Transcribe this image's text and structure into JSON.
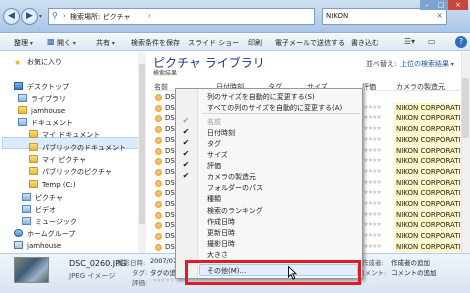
{
  "addressbar": {
    "path_text": "検索場所: ピクチャ",
    "refresh_icon": "refresh-arrows"
  },
  "search": {
    "value": "NIKON"
  },
  "toolbar": {
    "organize": "整理",
    "open": "開く",
    "share": "共有",
    "save_search": "検索条件を保存",
    "slideshow": "スライド ショー",
    "print": "印刷",
    "email": "電子メールで送信する",
    "burn": "書き込む"
  },
  "sidebar": {
    "items": [
      {
        "label": "お気に入り",
        "icon": "star"
      },
      {
        "label": "デスクトップ",
        "icon": "desktop"
      },
      {
        "label": "ライブラリ",
        "icon": "library"
      },
      {
        "label": "jamhouse",
        "icon": "user-folder"
      },
      {
        "label": "ドキュメント",
        "icon": "library"
      },
      {
        "label": "マイ ドキュメント",
        "icon": "folder"
      },
      {
        "label": "パブリックのドキュメント",
        "icon": "folder"
      },
      {
        "label": "マイ ピクチャ",
        "icon": "folder"
      },
      {
        "label": "パブリックのピクチャ",
        "icon": "folder"
      },
      {
        "label": "Temp (C:)",
        "icon": "folder"
      },
      {
        "label": "ピクチャ",
        "icon": "library"
      },
      {
        "label": "ビデオ",
        "icon": "library"
      },
      {
        "label": "ミュージック",
        "icon": "library"
      },
      {
        "label": "ホームグループ",
        "icon": "network"
      },
      {
        "label": "jamhouse",
        "icon": "computer"
      }
    ]
  },
  "library": {
    "title": "ピクチャ ライブラリ",
    "subtitle": "検索結果",
    "arrange_label": "並べ替え:",
    "arrange_value": "上位の検索結果"
  },
  "columns": {
    "name": "名前",
    "date": "日付時刻",
    "tag": "タグ",
    "size": "サイズ",
    "rating": "評価",
    "camera": "カメラの製造元"
  },
  "files": [
    {
      "name": "DSC_0",
      "camera": ""
    },
    {
      "name": "DSC_02",
      "camera": "NIKON CORPORATION"
    },
    {
      "name": "DSC_02",
      "camera": "NIKON CORPORATION"
    },
    {
      "name": "DSC_02",
      "camera": "NIKON CORPORATION"
    },
    {
      "name": "DSC_02",
      "camera": "NIKON CORPORATION"
    },
    {
      "name": "DSC_02",
      "camera": "NIKON CORPORATION"
    },
    {
      "name": "DSC_02",
      "camera": "NIKON CORPORATION"
    },
    {
      "name": "DSC_02",
      "camera": "NIKON CORPORATION"
    },
    {
      "name": "DSC_02",
      "camera": "NIKON CORPORATION"
    },
    {
      "name": "DSC_02",
      "camera": "NIKON CORPORATION"
    },
    {
      "name": "DSC_02",
      "camera": "NIKON CORPORATION"
    },
    {
      "name": "DSC_02",
      "camera": "NIKON CORPORATION"
    },
    {
      "name": "DSC_02",
      "camera": "NIKON CORPORATION"
    },
    {
      "name": "DSC_02",
      "camera": "NIKON CORPORATION"
    },
    {
      "name": "DSC_02",
      "camera": "NIKON CORPORATION"
    }
  ],
  "context_menu": {
    "items": [
      {
        "label": "列のサイズを自動的に変更する(S)",
        "checked": false,
        "disabled": false
      },
      {
        "label": "すべての列のサイズを自動的に変更する(A)",
        "checked": false,
        "disabled": false
      },
      {
        "label": "名前",
        "checked": true,
        "disabled": true
      },
      {
        "label": "日付時刻",
        "checked": true,
        "disabled": false
      },
      {
        "label": "タグ",
        "checked": true,
        "disabled": false
      },
      {
        "label": "サイズ",
        "checked": true,
        "disabled": false
      },
      {
        "label": "評価",
        "checked": true,
        "disabled": false
      },
      {
        "label": "カメラの製造元",
        "checked": true,
        "disabled": false
      },
      {
        "label": "フォルダーのパス",
        "checked": false,
        "disabled": false
      },
      {
        "label": "種類",
        "checked": false,
        "disabled": false
      },
      {
        "label": "検索のランキング",
        "checked": false,
        "disabled": false
      },
      {
        "label": "作成日時",
        "checked": false,
        "disabled": false
      },
      {
        "label": "更新日時",
        "checked": false,
        "disabled": false
      },
      {
        "label": "撮影日時",
        "checked": false,
        "disabled": false
      },
      {
        "label": "大きさ",
        "checked": false,
        "disabled": false
      },
      {
        "label": "その他(M)...",
        "checked": false,
        "disabled": false
      }
    ],
    "highlighted": "その他(M)..."
  },
  "details": {
    "filename": "DSC_0260.JPG",
    "type": "JPEG イメージ",
    "shoot_label": "撮影日時:",
    "shoot_value": "2007/07/14 1",
    "tag_label": "タグ:",
    "tag_value": "タグの追加",
    "rating_label": "評価:",
    "author_label": "作成者:",
    "author_value": "作成者の追加",
    "comment_label": "コメント:",
    "comment_value": "コメントの追加"
  },
  "colors": {
    "highlight_box": "#e01b24",
    "camera_cell_bg": "#fff8c6",
    "library_title": "#1e3287"
  }
}
